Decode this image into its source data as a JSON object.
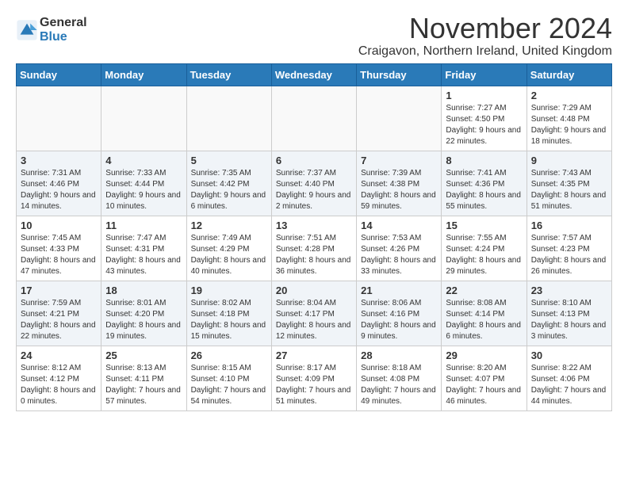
{
  "logo": {
    "general": "General",
    "blue": "Blue"
  },
  "title": "November 2024",
  "location": "Craigavon, Northern Ireland, United Kingdom",
  "days_of_week": [
    "Sunday",
    "Monday",
    "Tuesday",
    "Wednesday",
    "Thursday",
    "Friday",
    "Saturday"
  ],
  "weeks": [
    [
      {
        "day": "",
        "info": ""
      },
      {
        "day": "",
        "info": ""
      },
      {
        "day": "",
        "info": ""
      },
      {
        "day": "",
        "info": ""
      },
      {
        "day": "",
        "info": ""
      },
      {
        "day": "1",
        "info": "Sunrise: 7:27 AM\nSunset: 4:50 PM\nDaylight: 9 hours and 22 minutes."
      },
      {
        "day": "2",
        "info": "Sunrise: 7:29 AM\nSunset: 4:48 PM\nDaylight: 9 hours and 18 minutes."
      }
    ],
    [
      {
        "day": "3",
        "info": "Sunrise: 7:31 AM\nSunset: 4:46 PM\nDaylight: 9 hours and 14 minutes."
      },
      {
        "day": "4",
        "info": "Sunrise: 7:33 AM\nSunset: 4:44 PM\nDaylight: 9 hours and 10 minutes."
      },
      {
        "day": "5",
        "info": "Sunrise: 7:35 AM\nSunset: 4:42 PM\nDaylight: 9 hours and 6 minutes."
      },
      {
        "day": "6",
        "info": "Sunrise: 7:37 AM\nSunset: 4:40 PM\nDaylight: 9 hours and 2 minutes."
      },
      {
        "day": "7",
        "info": "Sunrise: 7:39 AM\nSunset: 4:38 PM\nDaylight: 8 hours and 59 minutes."
      },
      {
        "day": "8",
        "info": "Sunrise: 7:41 AM\nSunset: 4:36 PM\nDaylight: 8 hours and 55 minutes."
      },
      {
        "day": "9",
        "info": "Sunrise: 7:43 AM\nSunset: 4:35 PM\nDaylight: 8 hours and 51 minutes."
      }
    ],
    [
      {
        "day": "10",
        "info": "Sunrise: 7:45 AM\nSunset: 4:33 PM\nDaylight: 8 hours and 47 minutes."
      },
      {
        "day": "11",
        "info": "Sunrise: 7:47 AM\nSunset: 4:31 PM\nDaylight: 8 hours and 43 minutes."
      },
      {
        "day": "12",
        "info": "Sunrise: 7:49 AM\nSunset: 4:29 PM\nDaylight: 8 hours and 40 minutes."
      },
      {
        "day": "13",
        "info": "Sunrise: 7:51 AM\nSunset: 4:28 PM\nDaylight: 8 hours and 36 minutes."
      },
      {
        "day": "14",
        "info": "Sunrise: 7:53 AM\nSunset: 4:26 PM\nDaylight: 8 hours and 33 minutes."
      },
      {
        "day": "15",
        "info": "Sunrise: 7:55 AM\nSunset: 4:24 PM\nDaylight: 8 hours and 29 minutes."
      },
      {
        "day": "16",
        "info": "Sunrise: 7:57 AM\nSunset: 4:23 PM\nDaylight: 8 hours and 26 minutes."
      }
    ],
    [
      {
        "day": "17",
        "info": "Sunrise: 7:59 AM\nSunset: 4:21 PM\nDaylight: 8 hours and 22 minutes."
      },
      {
        "day": "18",
        "info": "Sunrise: 8:01 AM\nSunset: 4:20 PM\nDaylight: 8 hours and 19 minutes."
      },
      {
        "day": "19",
        "info": "Sunrise: 8:02 AM\nSunset: 4:18 PM\nDaylight: 8 hours and 15 minutes."
      },
      {
        "day": "20",
        "info": "Sunrise: 8:04 AM\nSunset: 4:17 PM\nDaylight: 8 hours and 12 minutes."
      },
      {
        "day": "21",
        "info": "Sunrise: 8:06 AM\nSunset: 4:16 PM\nDaylight: 8 hours and 9 minutes."
      },
      {
        "day": "22",
        "info": "Sunrise: 8:08 AM\nSunset: 4:14 PM\nDaylight: 8 hours and 6 minutes."
      },
      {
        "day": "23",
        "info": "Sunrise: 8:10 AM\nSunset: 4:13 PM\nDaylight: 8 hours and 3 minutes."
      }
    ],
    [
      {
        "day": "24",
        "info": "Sunrise: 8:12 AM\nSunset: 4:12 PM\nDaylight: 8 hours and 0 minutes."
      },
      {
        "day": "25",
        "info": "Sunrise: 8:13 AM\nSunset: 4:11 PM\nDaylight: 7 hours and 57 minutes."
      },
      {
        "day": "26",
        "info": "Sunrise: 8:15 AM\nSunset: 4:10 PM\nDaylight: 7 hours and 54 minutes."
      },
      {
        "day": "27",
        "info": "Sunrise: 8:17 AM\nSunset: 4:09 PM\nDaylight: 7 hours and 51 minutes."
      },
      {
        "day": "28",
        "info": "Sunrise: 8:18 AM\nSunset: 4:08 PM\nDaylight: 7 hours and 49 minutes."
      },
      {
        "day": "29",
        "info": "Sunrise: 8:20 AM\nSunset: 4:07 PM\nDaylight: 7 hours and 46 minutes."
      },
      {
        "day": "30",
        "info": "Sunrise: 8:22 AM\nSunset: 4:06 PM\nDaylight: 7 hours and 44 minutes."
      }
    ]
  ]
}
